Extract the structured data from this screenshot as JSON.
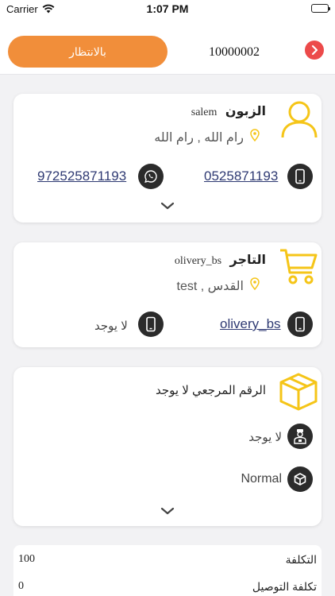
{
  "status_bar": {
    "carrier": "Carrier",
    "time": "1:07 PM"
  },
  "header": {
    "status_button": "بالانتظار",
    "order_number": "10000002"
  },
  "customer": {
    "label": "الزبون",
    "name": "salem",
    "location": "رام الله , رام الله",
    "whatsapp": "972525871193",
    "phone": "0525871193"
  },
  "merchant": {
    "label": "التاجر",
    "name": "olivery_bs",
    "location": "القدس , test",
    "phone_link": "olivery_bs",
    "phone2": "لا يوجد"
  },
  "details": {
    "reference": "الرقم المرجعي لا يوجد",
    "driver": "لا يوجد",
    "package_type": "Normal"
  },
  "totals": {
    "cost_label": "التكلفة",
    "cost_value": "100",
    "delivery_label": "تكلفة التوصيل",
    "delivery_value": "0"
  },
  "colors": {
    "accent": "#f18e3a",
    "icon_yellow": "#f5c518",
    "back": "#ec4a4a",
    "dark_circle": "#2b2b2b"
  },
  "icons": [
    "wifi-icon",
    "battery-icon",
    "chevron-right-icon",
    "person-icon",
    "location-pin-icon",
    "whatsapp-icon",
    "phone-icon",
    "chevron-down-icon",
    "cart-icon",
    "box-icon",
    "driver-icon",
    "package-icon"
  ]
}
